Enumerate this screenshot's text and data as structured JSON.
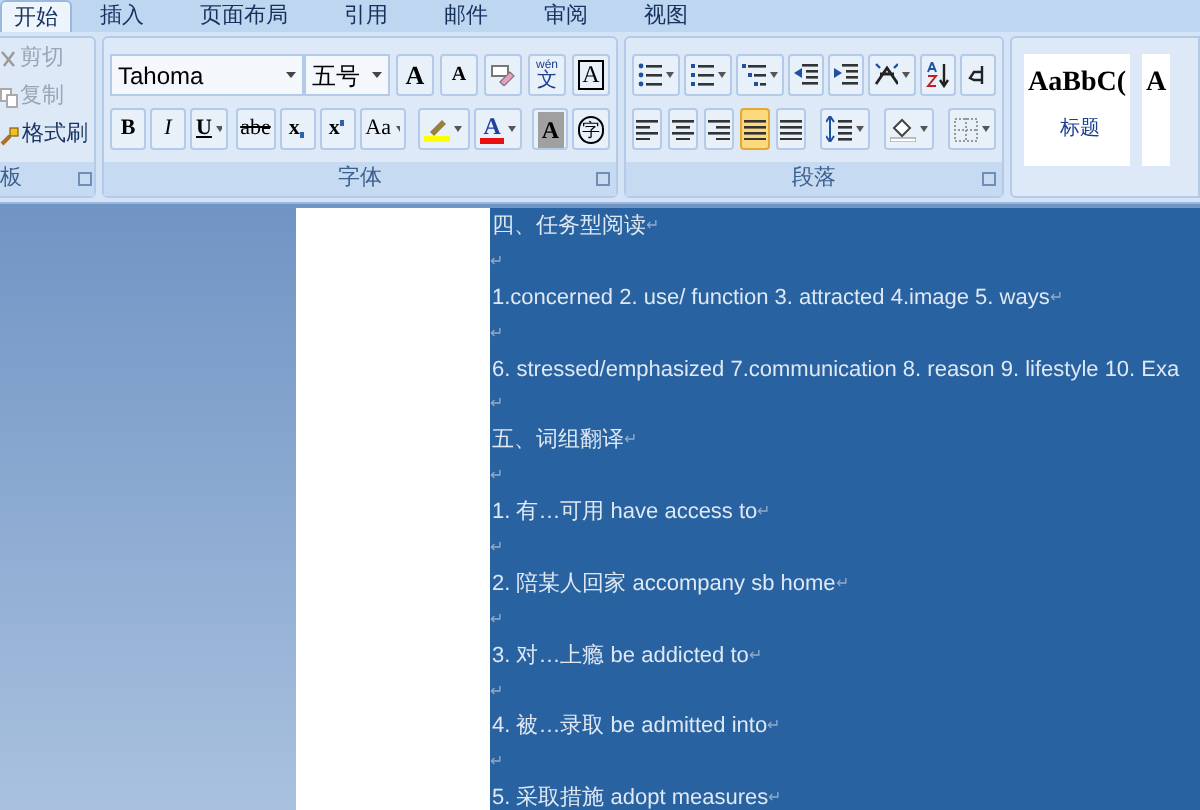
{
  "tabs": [
    {
      "label": "开始",
      "selected": true
    },
    {
      "label": "插入",
      "selected": false
    },
    {
      "label": "页面布局",
      "selected": false
    },
    {
      "label": "引用",
      "selected": false
    },
    {
      "label": "邮件",
      "selected": false
    },
    {
      "label": "审阅",
      "selected": false
    },
    {
      "label": "视图",
      "selected": false
    }
  ],
  "clipboard": {
    "items": [
      {
        "kind": "cut",
        "label": "剪切",
        "disabled": true
      },
      {
        "kind": "copy",
        "label": "复制",
        "disabled": true
      },
      {
        "kind": "painter",
        "label": "格式刷",
        "disabled": false
      }
    ],
    "group_label": "板"
  },
  "font": {
    "font_name": "Tahoma",
    "font_size": "五号",
    "row1": [
      {
        "kind": "grow",
        "label": "A"
      },
      {
        "kind": "shrink",
        "label": "A"
      },
      {
        "kind": "clear"
      },
      {
        "kind": "phonetic",
        "top": "wén",
        "label": "文"
      },
      {
        "kind": "boxed",
        "label": "A"
      }
    ],
    "row2": [
      {
        "kind": "bold",
        "label": "B"
      },
      {
        "kind": "italic",
        "label": "I"
      },
      {
        "kind": "underline",
        "label": "U"
      },
      {
        "kind": "strike",
        "label": "abe"
      },
      {
        "kind": "sub",
        "label": "x"
      },
      {
        "kind": "sup",
        "label": "x"
      },
      {
        "kind": "case",
        "label": "Aa"
      },
      {
        "kind": "highlight"
      },
      {
        "kind": "color",
        "label": "A",
        "color": "#e81010"
      },
      {
        "kind": "shade",
        "label": "A"
      },
      {
        "kind": "enclose",
        "label": "字"
      }
    ],
    "group_label": "字体"
  },
  "paragraph": {
    "row1": [
      {
        "kind": "bullets"
      },
      {
        "kind": "numbering"
      },
      {
        "kind": "multilevel"
      },
      {
        "kind": "outdent"
      },
      {
        "kind": "indent"
      },
      {
        "kind": "asian-layout"
      },
      {
        "kind": "sort"
      },
      {
        "kind": "marks"
      }
    ],
    "align": [
      {
        "kind": "left",
        "selected": false
      },
      {
        "kind": "center",
        "selected": false
      },
      {
        "kind": "right",
        "selected": false
      },
      {
        "kind": "justify",
        "selected": true
      },
      {
        "kind": "distribute",
        "selected": false
      }
    ],
    "group_label": "段落"
  },
  "styles": [
    {
      "sample": "AaBbC(",
      "name": "标题"
    },
    {
      "sample": "A"
    }
  ],
  "document": {
    "paragraphs": [
      {
        "text": "四、任务型阅读",
        "mark": "↵"
      },
      {
        "mark": "↵"
      },
      {
        "text": "1.concerned 2. use/ function 3. attracted 4.image 5. ways",
        "mark": "↵"
      },
      {
        "mark": "↵"
      },
      {
        "text": "6. stressed/emphasized  7.communication 8. reason 9. lifestyle 10. Exa"
      },
      {
        "mark": "↵"
      },
      {
        "text": "五、词组翻译",
        "mark": "↵"
      },
      {
        "mark": "↵"
      },
      {
        "text": "1. 有…可用  have access  to",
        "mark": "↵"
      },
      {
        "mark": "↵"
      },
      {
        "text": "2. 陪某人回家 accompany sb home",
        "mark": "↵"
      },
      {
        "mark": "↵"
      },
      {
        "text": "3. 对…上瘾 be addicted to",
        "mark": "↵"
      },
      {
        "mark": "↵"
      },
      {
        "text": "4. 被…录取 be admitted into",
        "mark": "↵"
      },
      {
        "mark": "↵"
      },
      {
        "text": "5. 采取措施 adopt measures",
        "mark": "↵"
      }
    ]
  }
}
